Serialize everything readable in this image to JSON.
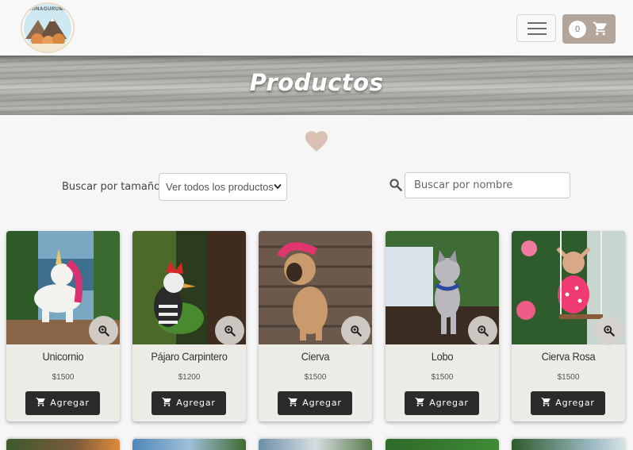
{
  "navbar": {
    "logo_text": "CHINAGURUMIS",
    "cart_count": "0"
  },
  "banner": {
    "title": "Productos"
  },
  "filters": {
    "size_label": "Buscar por tamaño:",
    "size_selected": "Ver todos los productos",
    "search_placeholder": "Buscar por nombre"
  },
  "products": [
    {
      "name": "Unicornio",
      "price": "$1500",
      "button": "Agregar"
    },
    {
      "name": "Pájaro Carpintero",
      "price": "$1200",
      "button": "Agregar"
    },
    {
      "name": "Cierva",
      "price": "$1500",
      "button": "Agregar"
    },
    {
      "name": "Lobo",
      "price": "$1500",
      "button": "Agregar"
    },
    {
      "name": "Cierva Rosa",
      "price": "$1500",
      "button": "Agregar"
    }
  ],
  "colors": {
    "cart_button": "#b4a59b",
    "heart": "#d9c1b6",
    "add_button": "#2b2b2b",
    "card_bg": "#ecebe6"
  },
  "icons": [
    "menu-icon",
    "cart-icon",
    "heart-icon",
    "search-icon",
    "zoom-icon",
    "add-to-cart-icon",
    "chevron-down-icon"
  ]
}
